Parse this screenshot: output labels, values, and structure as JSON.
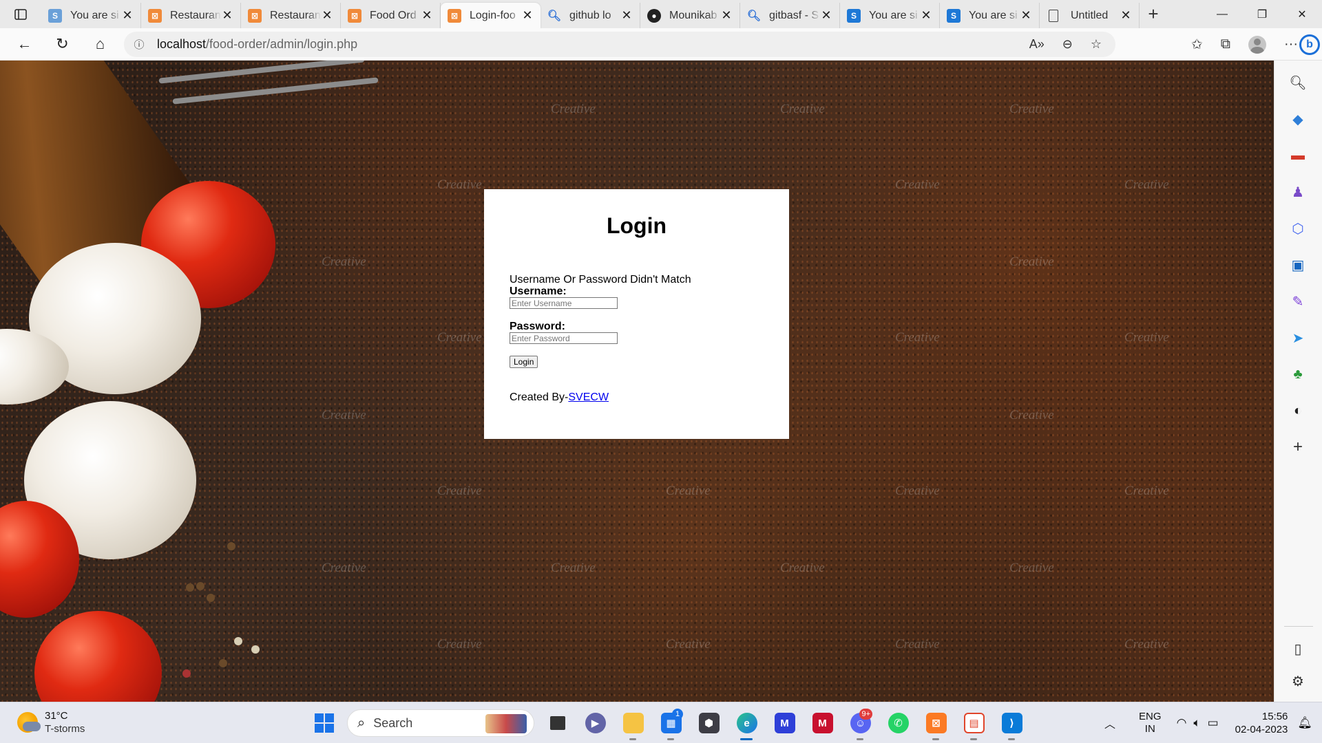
{
  "browser": {
    "tabs": [
      {
        "title": "You are si",
        "favicon": "s-icon",
        "active": false
      },
      {
        "title": "Restauran",
        "favicon": "xampp-icon",
        "active": false
      },
      {
        "title": "Restauran",
        "favicon": "xampp-icon",
        "active": false
      },
      {
        "title": "Food Ord",
        "favicon": "xampp-icon",
        "active": false
      },
      {
        "title": "Login-foo",
        "favicon": "xampp-icon",
        "active": true
      },
      {
        "title": "github lo",
        "favicon": "search-icon",
        "active": false
      },
      {
        "title": "Mounikab",
        "favicon": "github-icon",
        "active": false
      },
      {
        "title": "gitbasf - S",
        "favicon": "search-icon",
        "active": false
      },
      {
        "title": "You are si",
        "favicon": "s-icon",
        "active": false
      },
      {
        "title": "You are si",
        "favicon": "s-icon",
        "active": false
      },
      {
        "title": "Untitled",
        "favicon": "document-icon",
        "active": false
      }
    ],
    "address": {
      "host": "localhost",
      "path": "/food-order/admin/login.php"
    }
  },
  "page": {
    "login": {
      "title": "Login",
      "error_message": "Username Or Password Didn't Match",
      "username_label": "Username:",
      "username_placeholder": "Enter Username",
      "password_label": "Password:",
      "password_placeholder": "Enter Password",
      "submit_label": "Login",
      "credits_prefix": "Created By-",
      "credits_link": "SVECW"
    },
    "watermark_text": "Creative"
  },
  "taskbar": {
    "weather": {
      "temp": "31°C",
      "condition": "T-storms"
    },
    "search_label": "Search",
    "store_badge": "1",
    "discord_badge": "9+",
    "lang": {
      "line1": "ENG",
      "line2": "IN"
    },
    "clock": {
      "time": "15:56",
      "date": "02-04-2023"
    }
  },
  "colors": {
    "link": "#0000ee",
    "card_bg": "#ffffff",
    "taskbar_accent": "#0067c0"
  }
}
